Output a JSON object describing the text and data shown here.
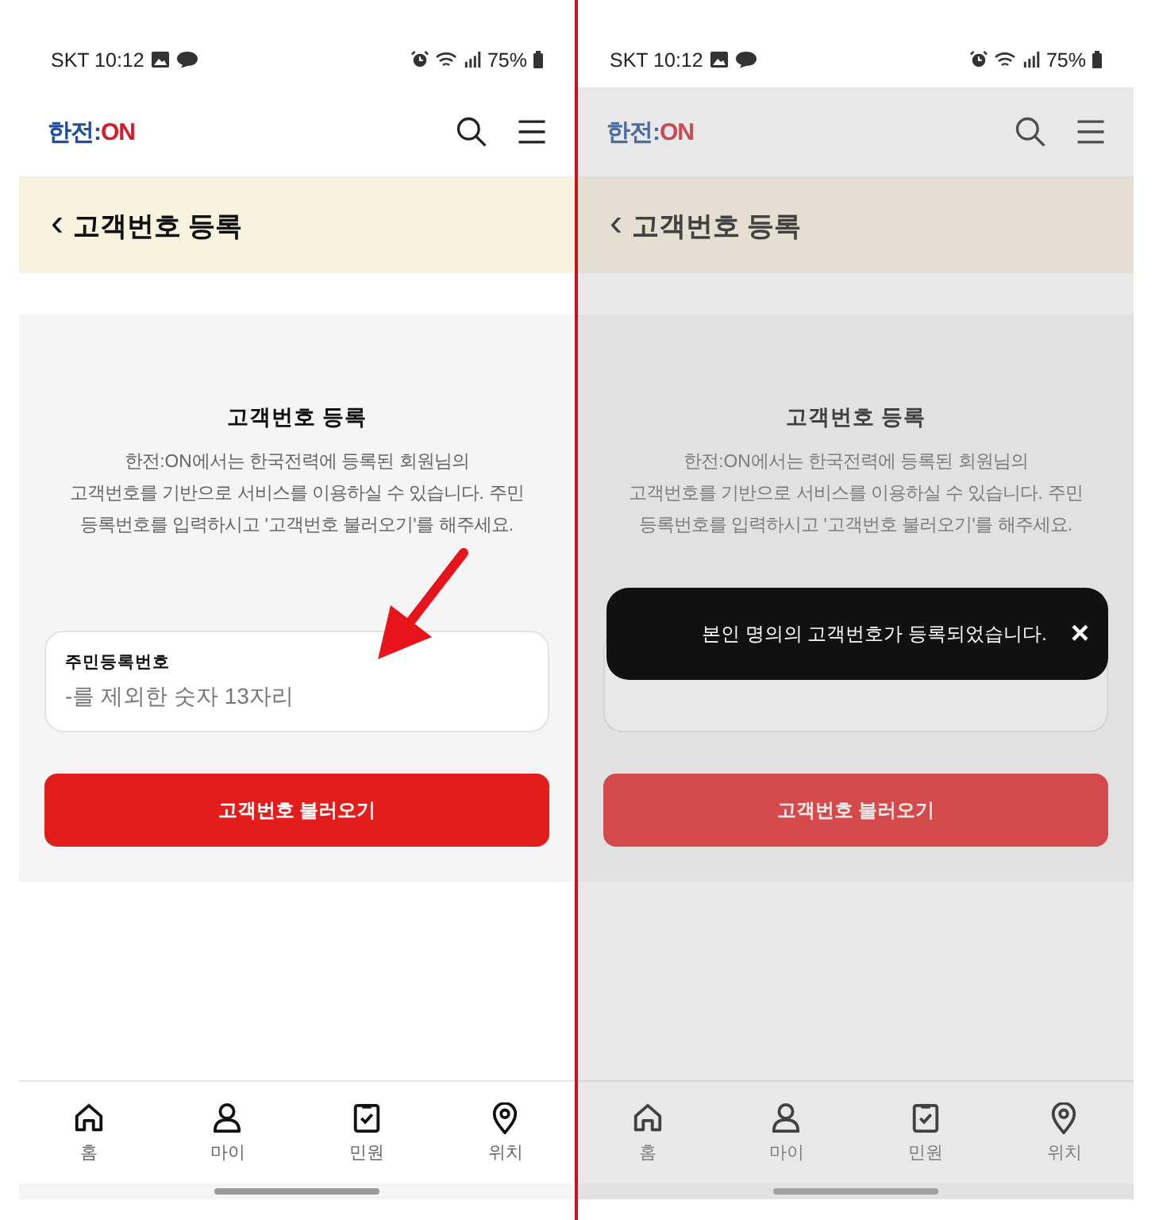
{
  "phones": [
    {
      "dimmed": false,
      "status_bar": {
        "carrier_time": "SKT 10:12",
        "battery": "75%"
      },
      "header": {
        "logo": [
          "한전:",
          "ON"
        ]
      },
      "page_title": {
        "back": "‹",
        "title": "고객번호 등록"
      },
      "section": {
        "heading": "고객번호 등록",
        "description": [
          "한전:ON에서는 한국전력에 등록된 회원님의",
          "고객번호를 기반으로 서비스를 이용하실 수 있습니다. 주민",
          "등록번호를 입력하시고 '고객번호 불러오기'를 해주세요."
        ],
        "field": {
          "covered": false,
          "label": "주민등록번호",
          "placeholder": "-를 제외한 숫자 13자리"
        },
        "button": "고객번호 불러오기"
      },
      "nav": [
        {
          "kind": "home",
          "label": "홈"
        },
        {
          "kind": "person",
          "label": "마이"
        },
        {
          "kind": "clipboard",
          "label": "민원"
        },
        {
          "kind": "pin",
          "label": "위치"
        }
      ]
    },
    {
      "dimmed": true,
      "status_bar": {
        "carrier_time": "SKT 10:12",
        "battery": "75%"
      },
      "header": {
        "logo": [
          "한전:",
          "ON"
        ]
      },
      "page_title": {
        "back": "‹",
        "title": "고객번호 등록"
      },
      "section": {
        "heading": "고객번호 등록",
        "description": [
          "한전:ON에서는 한국전력에 등록된 회원님의",
          "고객번호를 기반으로 서비스를 이용하실 수 있습니다. 주민",
          "등록번호를 입력하시고 '고객번호 불러오기'를 해주세요."
        ],
        "field": {
          "covered": true
        },
        "button": "고객번호 불러오기"
      },
      "nav": [
        {
          "kind": "home",
          "label": "홈"
        },
        {
          "kind": "person",
          "label": "마이"
        },
        {
          "kind": "clipboard",
          "label": "민원"
        },
        {
          "kind": "pin",
          "label": "위치"
        }
      ],
      "toast": {
        "message": "본인 명의의 고객번호가 등록되었습니다.",
        "close": "×"
      }
    }
  ]
}
